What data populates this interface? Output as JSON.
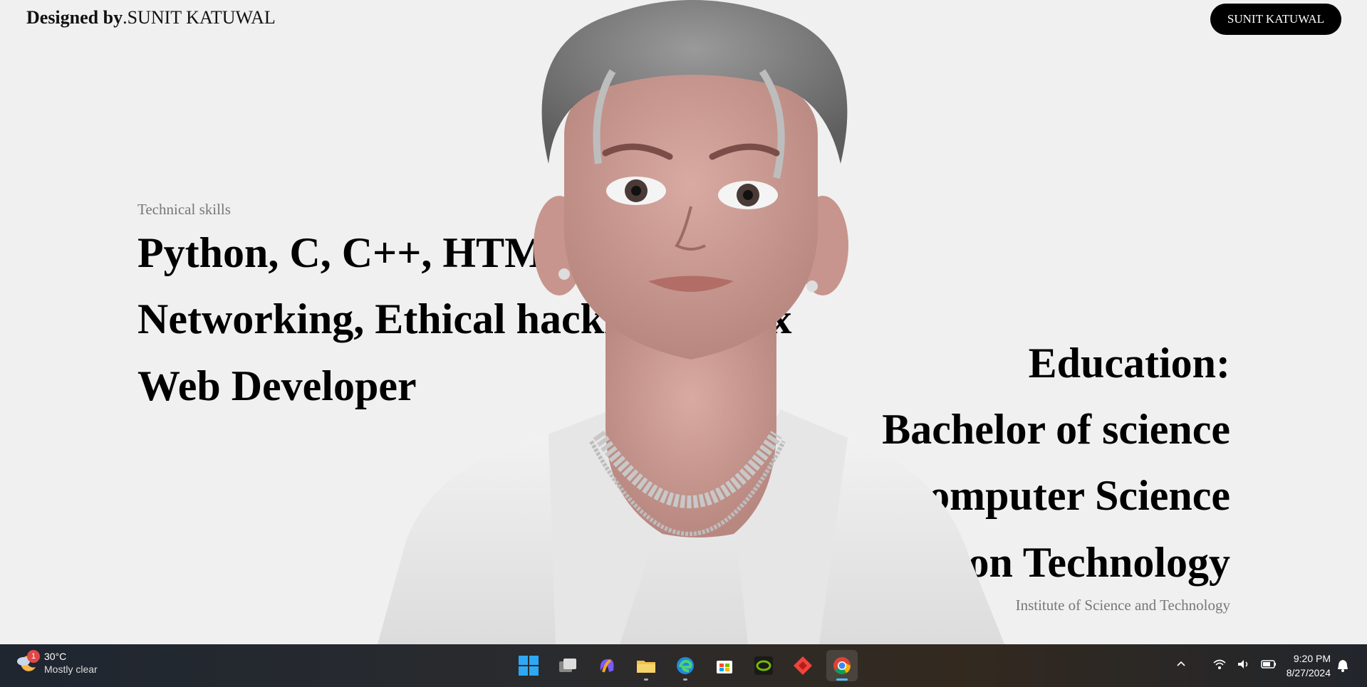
{
  "header": {
    "brand_prefix": "Designed by",
    "brand_name": ".SUNIT KATUWAL",
    "cta_label": "SUNIT KATUWAL"
  },
  "skills": {
    "label": "Technical skills",
    "lines": [
      "Python, C, C++, HTML",
      "Networking, Ethical hacking, Linux",
      "Web Developer"
    ]
  },
  "education": {
    "heading": "Education:",
    "lines": [
      "Bachelor of science",
      "in computer Science",
      "and Information Technology"
    ],
    "institution": "Institute of Science and Technology"
  },
  "taskbar": {
    "weather": {
      "temp": "30°C",
      "condition": "Mostly clear",
      "badge": "1"
    },
    "apps": [
      {
        "name": "start",
        "icon": "windows-logo-icon"
      },
      {
        "name": "task-view",
        "icon": "task-view-icon"
      },
      {
        "name": "copilot",
        "icon": "copilot-icon"
      },
      {
        "name": "file-explorer",
        "icon": "folder-icon"
      },
      {
        "name": "edge",
        "icon": "edge-icon"
      },
      {
        "name": "store",
        "icon": "store-icon"
      },
      {
        "name": "nvidia",
        "icon": "nvidia-icon"
      },
      {
        "name": "anydesk",
        "icon": "anydesk-icon"
      },
      {
        "name": "chrome",
        "icon": "chrome-icon",
        "active": true
      }
    ],
    "clock": {
      "time": "9:20 PM",
      "date": "8/27/2024"
    }
  },
  "colors": {
    "background": "#f0f0f0",
    "text": "#000000",
    "muted": "#777777",
    "button": "#000000"
  }
}
